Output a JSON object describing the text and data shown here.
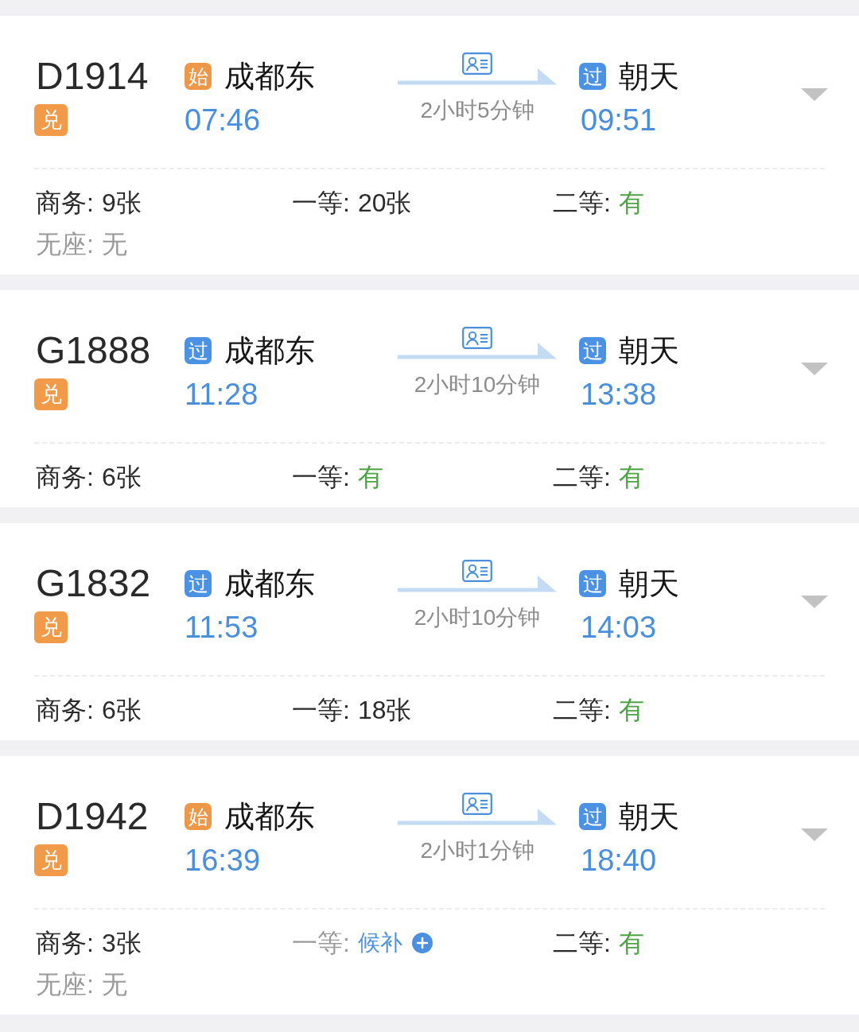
{
  "trains": [
    {
      "number": "D1914",
      "badge": "兑",
      "depart": {
        "badge": "始",
        "kind": "origin",
        "station": "成都东",
        "time": "07:46"
      },
      "duration": "2小时5分钟",
      "arrive": {
        "badge": "过",
        "kind": "pass",
        "station": "朝天",
        "time": "09:51"
      },
      "seats": [
        {
          "label": "商务:",
          "value": "9张",
          "kind": "count"
        },
        {
          "label": "一等:",
          "value": "20张",
          "kind": "count"
        },
        {
          "label": "二等:",
          "value": "有",
          "kind": "available"
        },
        {
          "label": "无座:",
          "value": "无",
          "kind": "none"
        }
      ]
    },
    {
      "number": "G1888",
      "badge": "兑",
      "depart": {
        "badge": "过",
        "kind": "pass",
        "station": "成都东",
        "time": "11:28"
      },
      "duration": "2小时10分钟",
      "arrive": {
        "badge": "过",
        "kind": "pass",
        "station": "朝天",
        "time": "13:38"
      },
      "seats": [
        {
          "label": "商务:",
          "value": "6张",
          "kind": "count"
        },
        {
          "label": "一等:",
          "value": "有",
          "kind": "available"
        },
        {
          "label": "二等:",
          "value": "有",
          "kind": "available"
        }
      ]
    },
    {
      "number": "G1832",
      "badge": "兑",
      "depart": {
        "badge": "过",
        "kind": "pass",
        "station": "成都东",
        "time": "11:53"
      },
      "duration": "2小时10分钟",
      "arrive": {
        "badge": "过",
        "kind": "pass",
        "station": "朝天",
        "time": "14:03"
      },
      "seats": [
        {
          "label": "商务:",
          "value": "6张",
          "kind": "count"
        },
        {
          "label": "一等:",
          "value": "18张",
          "kind": "count"
        },
        {
          "label": "二等:",
          "value": "有",
          "kind": "available"
        }
      ]
    },
    {
      "number": "D1942",
      "badge": "兑",
      "depart": {
        "badge": "始",
        "kind": "origin",
        "station": "成都东",
        "time": "16:39"
      },
      "duration": "2小时1分钟",
      "arrive": {
        "badge": "过",
        "kind": "pass",
        "station": "朝天",
        "time": "18:40"
      },
      "seats": [
        {
          "label": "商务:",
          "value": "3张",
          "kind": "count"
        },
        {
          "label": "一等:",
          "value": "候补",
          "kind": "waitlist"
        },
        {
          "label": "二等:",
          "value": "有",
          "kind": "available"
        },
        {
          "label": "无座:",
          "value": "无",
          "kind": "none"
        }
      ]
    }
  ]
}
